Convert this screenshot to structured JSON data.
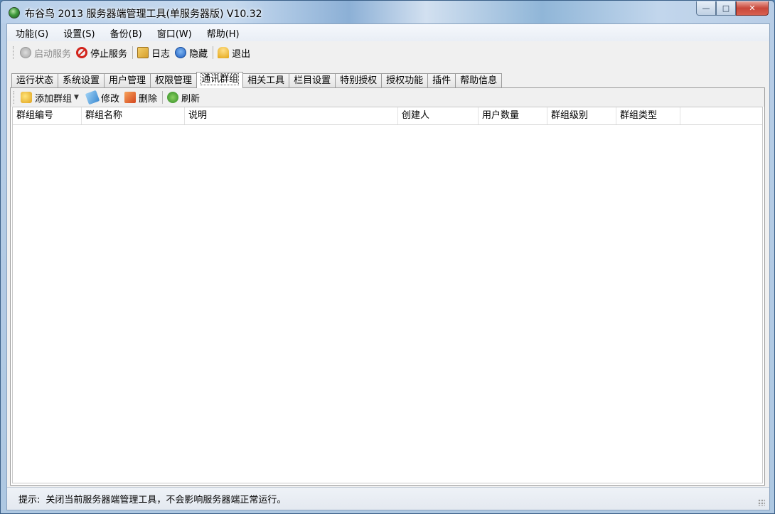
{
  "window": {
    "title": "布谷鸟 2013 服务器端管理工具(单服务器版) V10.32",
    "app_icon": "globe-icon"
  },
  "menubar": [
    {
      "label": "功能(G)"
    },
    {
      "label": "设置(S)"
    },
    {
      "label": "备份(B)"
    },
    {
      "label": "窗口(W)"
    },
    {
      "label": "帮助(H)"
    }
  ],
  "toolbar": {
    "start_service": "启动服务",
    "stop_service": "停止服务",
    "log": "日志",
    "hide": "隐藏",
    "exit": "退出"
  },
  "tabs": [
    {
      "label": "运行状态",
      "active": false
    },
    {
      "label": "系统设置",
      "active": false
    },
    {
      "label": "用户管理",
      "active": false
    },
    {
      "label": "权限管理",
      "active": false
    },
    {
      "label": "通讯群组",
      "active": true
    },
    {
      "label": "相关工具",
      "active": false
    },
    {
      "label": "栏目设置",
      "active": false
    },
    {
      "label": "特别授权",
      "active": false
    },
    {
      "label": "授权功能",
      "active": false
    },
    {
      "label": "插件",
      "active": false
    },
    {
      "label": "帮助信息",
      "active": false
    }
  ],
  "group_toolbar": {
    "add_group": "添加群组",
    "edit": "修改",
    "delete": "删除",
    "refresh": "刷新"
  },
  "grid": {
    "columns": [
      "群组编号",
      "群组名称",
      "说明",
      "创建人",
      "用户数量",
      "群组级别",
      "群组类型"
    ],
    "rows": []
  },
  "statusbar": {
    "label": "提示:",
    "message": "关闭当前服务器端管理工具，不会影响服务器端正常运行。"
  },
  "colors": {
    "titlebar": "#b9d0ea",
    "client_bg": "#f0f0f0",
    "close_button": "#c8473a"
  }
}
